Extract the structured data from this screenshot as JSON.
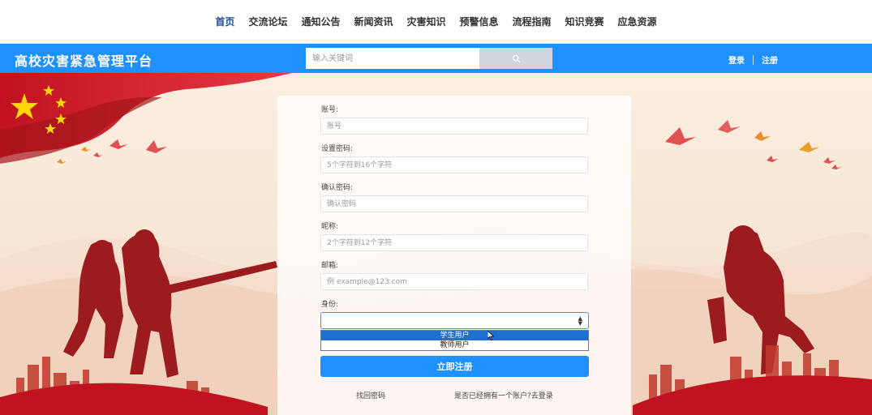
{
  "nav": {
    "items": [
      "首页",
      "交流论坛",
      "通知公告",
      "新闻资讯",
      "灾害知识",
      "预警信息",
      "流程指南",
      "知识竞赛",
      "应急资源"
    ],
    "active_index": 0
  },
  "header": {
    "site_title": "高校灾害紧急管理平台",
    "search_placeholder": "输入关键词",
    "login": "登录",
    "register": "注册"
  },
  "form": {
    "account_label": "账号:",
    "account_placeholder": "账号",
    "password_label": "设置密码:",
    "password_placeholder": "5个字符到16个字符",
    "confirm_label": "确认密码:",
    "confirm_placeholder": "确认密码",
    "nickname_label": "昵称:",
    "nickname_placeholder": "2个字符到12个字符",
    "email_label": "邮箱:",
    "email_placeholder": "例 example@123.com",
    "role_label": "身份:",
    "role_options": [
      "学生用户",
      "教师用户"
    ],
    "role_highlighted": 0,
    "submit": "立即注册",
    "forgot": "找回密码",
    "has_account": "是否已经拥有一个账户?去登录"
  },
  "colors": {
    "brand_blue": "#1e90ff",
    "nav_active": "#1a4f93",
    "option_highlight": "#1e6fd0"
  },
  "icons": {
    "search": "search-icon",
    "select_arrows": "select-arrows-icon",
    "cursor": "mouse-cursor-icon"
  }
}
